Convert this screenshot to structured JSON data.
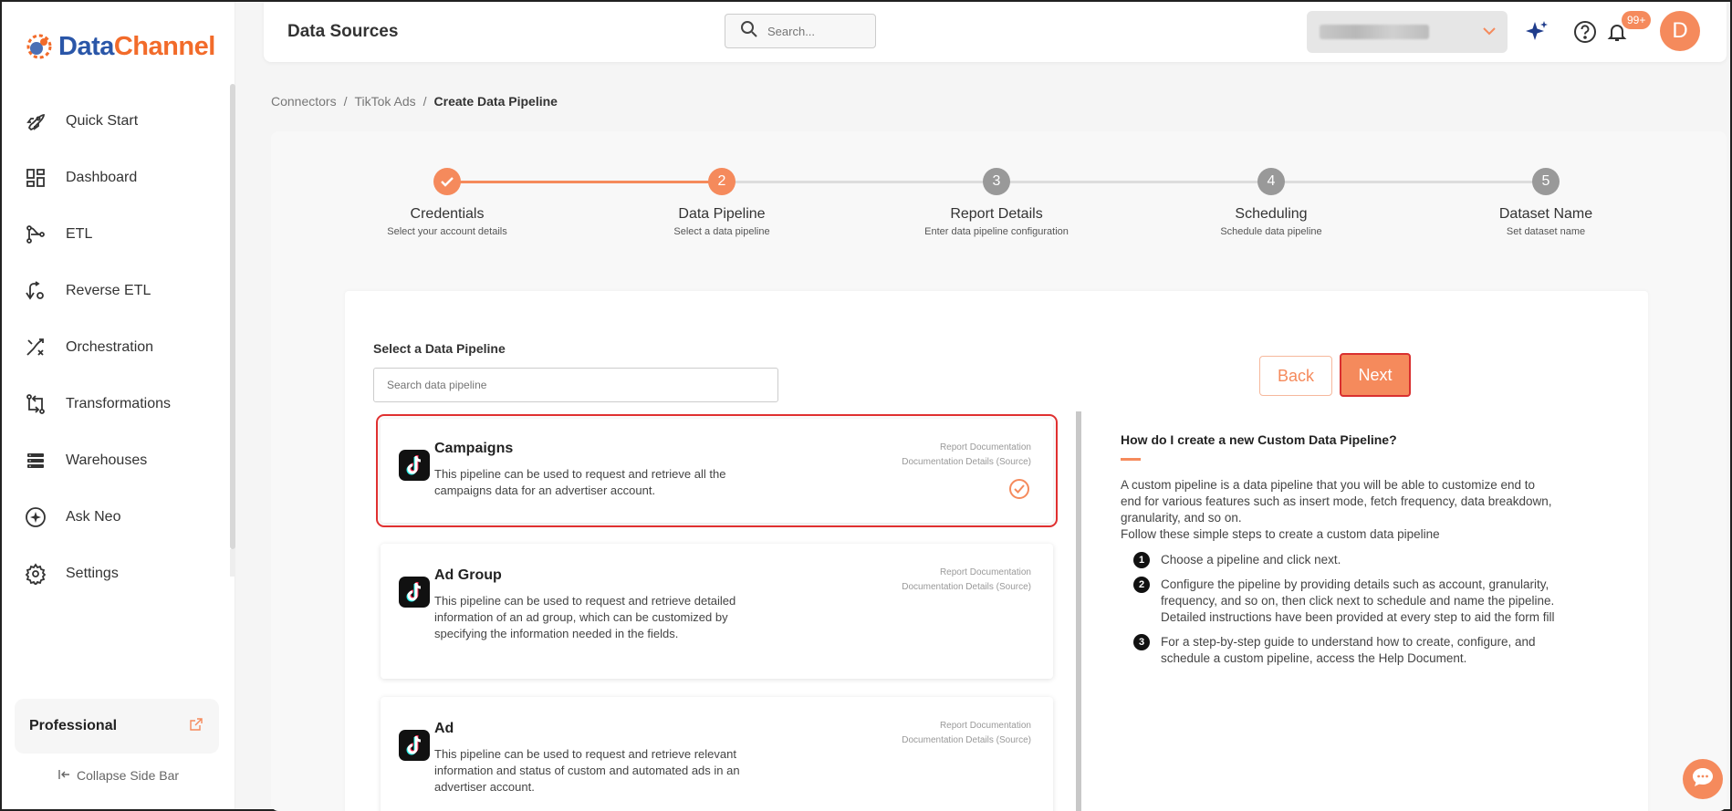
{
  "app": {
    "logo_part1": "Data",
    "logo_part2": "Channel"
  },
  "sidebar": {
    "items": [
      {
        "label": "Quick Start",
        "icon": "rocket-icon"
      },
      {
        "label": "Dashboard",
        "icon": "dashboard-icon"
      },
      {
        "label": "ETL",
        "icon": "etl-icon"
      },
      {
        "label": "Reverse ETL",
        "icon": "reverse-etl-icon"
      },
      {
        "label": "Orchestration",
        "icon": "orchestration-icon"
      },
      {
        "label": "Transformations",
        "icon": "transformations-icon"
      },
      {
        "label": "Warehouses",
        "icon": "warehouses-icon"
      },
      {
        "label": "Ask Neo",
        "icon": "sparkle-icon"
      },
      {
        "label": "Settings",
        "icon": "gear-icon"
      }
    ],
    "plan": "Professional",
    "collapse": "Collapse Side Bar"
  },
  "header": {
    "title": "Data Sources",
    "search_placeholder": "Search...",
    "notifications": "99+",
    "avatar": "D"
  },
  "breadcrumb": {
    "items": [
      "Connectors",
      "TikTok Ads",
      "Create Data Pipeline"
    ],
    "sep": "/"
  },
  "stepper": {
    "steps": [
      {
        "num": "",
        "title": "Credentials",
        "sub": "Select your account details",
        "state": "done"
      },
      {
        "num": "2",
        "title": "Data Pipeline",
        "sub": "Select a data pipeline",
        "state": "active"
      },
      {
        "num": "3",
        "title": "Report Details",
        "sub": "Enter data pipeline configuration",
        "state": "pending"
      },
      {
        "num": "4",
        "title": "Scheduling",
        "sub": "Schedule data pipeline",
        "state": "pending"
      },
      {
        "num": "5",
        "title": "Dataset Name",
        "sub": "Set dataset name",
        "state": "pending"
      }
    ]
  },
  "selector": {
    "label": "Select a Data Pipeline",
    "search_placeholder": "Search data pipeline",
    "back": "Back",
    "next": "Next"
  },
  "pipelines": [
    {
      "title": "Campaigns",
      "desc": "This pipeline can be used to request and retrieve all the campaigns data for an advertiser account.",
      "link1": "Report Documentation",
      "link2": "Documentation Details (Source)"
    },
    {
      "title": "Ad Group",
      "desc": "This pipeline can be used to request and retrieve detailed information of an ad group, which can be customized by specifying the information needed in the fields.",
      "link1": "Report Documentation",
      "link2": "Documentation Details (Source)"
    },
    {
      "title": "Ad",
      "desc": "This pipeline can be used to request and retrieve relevant information and status of custom and automated ads in an advertiser account.",
      "link1": "Report Documentation",
      "link2": "Documentation Details (Source)"
    }
  ],
  "help": {
    "title": "How do I create a new Custom Data Pipeline?",
    "para1": "A custom pipeline is a data pipeline that you will be able to customize end to end for various features such as insert mode, fetch frequency, data breakdown, granularity, and so on.",
    "para2": "Follow these simple steps to create a custom data pipeline",
    "steps": [
      {
        "num": "1",
        "text": "Choose a pipeline and click next."
      },
      {
        "num": "2",
        "text": "Configure the pipeline by providing details such as account, granularity, frequency, and so on, then click next to schedule and name the pipeline. Detailed instructions have been provided at every step to aid the form fill"
      },
      {
        "num": "3",
        "text": "For a step-by-step guide to understand how to create, configure, and schedule a custom pipeline, access the Help Document."
      }
    ]
  },
  "colors": {
    "accent": "#f58a5c",
    "brand_blue": "#2a56a8",
    "brand_orange": "#f26b2a",
    "highlight_red": "#e03030"
  }
}
